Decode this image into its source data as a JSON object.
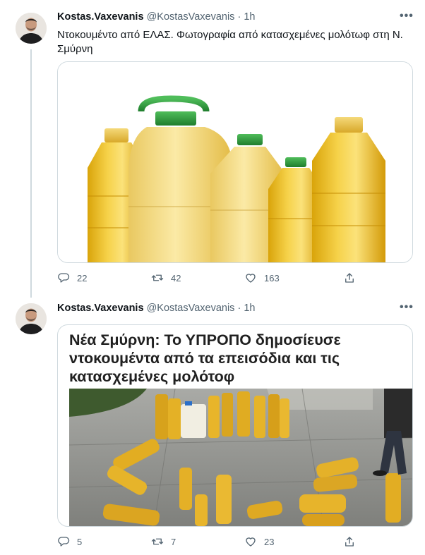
{
  "tweets": [
    {
      "author_name": "Kostas.Vaxevanis",
      "handle": "@KostasVaxevanis",
      "separator": "·",
      "time": "1h",
      "more_label": "•••",
      "text": "Ντοκουμέντο από ΕΛΑΣ. Φωτογραφία από κατασχεμένες μολότωφ στη Ν. Σμύρνη",
      "stats": {
        "replies": "22",
        "retweets": "42",
        "likes": "163"
      }
    },
    {
      "author_name": "Kostas.Vaxevanis",
      "handle": "@KostasVaxevanis",
      "separator": "·",
      "time": "1h",
      "more_label": "•••",
      "article_headline": "Νέα Σμύρνη: Το ΥΠΡΟΠΟ δημοσίευσε ντοκουμέντα από τα επεισόδια και τις κατασχεμένες μολότοφ",
      "stats": {
        "replies": "5",
        "retweets": "7",
        "likes": "23"
      }
    }
  ],
  "icons": [
    "reply-icon",
    "retweet-icon",
    "like-icon",
    "share-icon",
    "more-icon"
  ],
  "colors": {
    "secondary_text": "#536471",
    "border": "#cfd9de",
    "oil": "#f2c421",
    "cap_green": "#2e9a3e"
  }
}
